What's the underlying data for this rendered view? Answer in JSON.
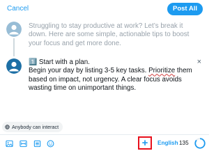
{
  "header": {
    "cancel_label": "Cancel",
    "post_all_label": "Post All"
  },
  "thread": {
    "tweet1_text": "Struggling to stay productive at work? Let’s break it down. Here are some simple, actionable tips to boost your focus and get more done.",
    "tweet2_line1": "1️⃣ Start with a plan.",
    "tweet2_line2_pre": "Begin your day by listing 3-5 key tasks. ",
    "tweet2_line2_spell": "Prioritize",
    "tweet2_line2_post": " them based on impact, not urgency. A clear focus avoids wasting time on unimportant things.",
    "close_glyph": "×"
  },
  "reply_setting": {
    "label": "Anybody can interact",
    "icon": "globe-icon"
  },
  "toolbar": {
    "tools": [
      "image-icon",
      "gif-icon",
      "list-icon",
      "emoji-icon"
    ],
    "add_label": "+",
    "language": "English",
    "char_count": "135",
    "char_progress": 0.86
  },
  "colors": {
    "accent": "#1d9bf0",
    "highlight_border": "#e8101c",
    "muted_text": "#98a2ab"
  }
}
